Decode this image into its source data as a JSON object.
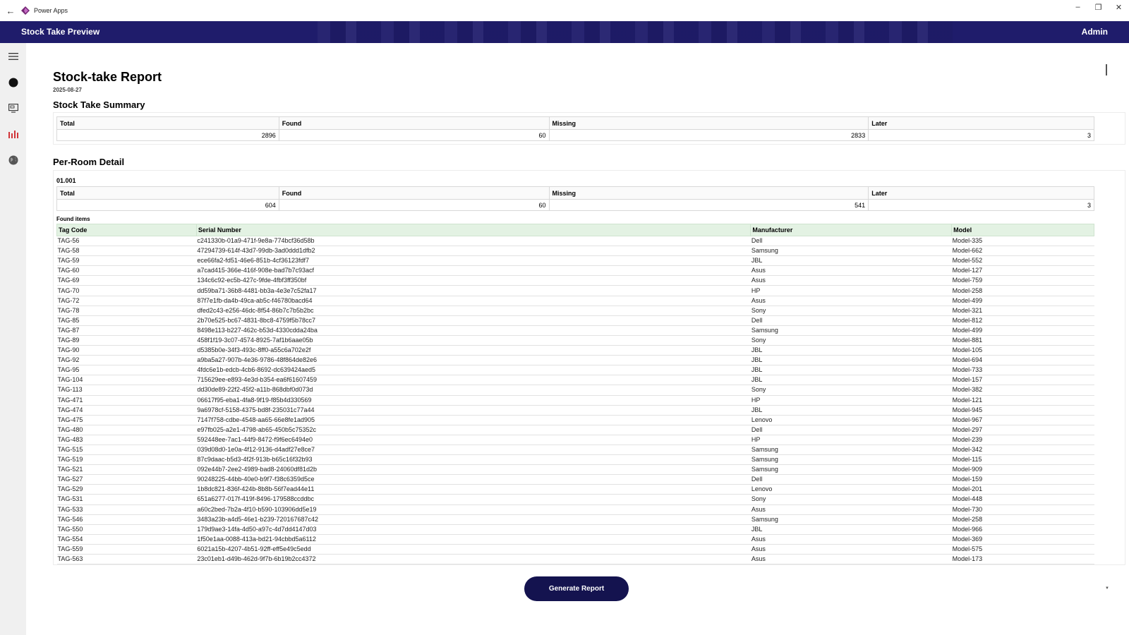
{
  "window": {
    "app_name": "Power Apps",
    "controls": [
      "minimize",
      "restore",
      "close"
    ]
  },
  "header": {
    "title": "Stock Take Preview",
    "user": "Admin",
    "bg_color": "#1f1c6b"
  },
  "sidebar": {
    "icons": [
      "menu-icon",
      "circle-icon",
      "monitor-icon",
      "bar-chart-icon",
      "globe-icon"
    ],
    "active_color": "#d13438"
  },
  "report": {
    "title": "Stock-take Report",
    "date": "2025-08-27",
    "summary_title": "Stock Take Summary",
    "summary": {
      "headers": [
        "Total",
        "Found",
        "Missing",
        "Later"
      ],
      "values": [
        "2896",
        "60",
        "2833",
        "3"
      ]
    },
    "per_room_title": "Per-Room Detail",
    "room": {
      "name": "01.001",
      "headers": [
        "Total",
        "Found",
        "Missing",
        "Later"
      ],
      "values": [
        "604",
        "60",
        "541",
        "3"
      ],
      "found_items_label": "Found items",
      "item_headers": [
        "Tag Code",
        "Serial Number",
        "Manufacturer",
        "Model"
      ],
      "items": [
        [
          "TAG-56",
          "c241330b-01a9-471f-9e8a-774bcf36d58b",
          "Dell",
          "Model-335"
        ],
        [
          "TAG-58",
          "47294739-614f-43d7-99db-3ad0ddd1dfb2",
          "Samsung",
          "Model-662"
        ],
        [
          "TAG-59",
          "ece66fa2-fd51-46e6-851b-4cf36123fdf7",
          "JBL",
          "Model-552"
        ],
        [
          "TAG-60",
          "a7cad415-366e-416f-908e-bad7b7c93acf",
          "Asus",
          "Model-127"
        ],
        [
          "TAG-69",
          "134c6c92-ec5b-427c-9fde-4fbf3ff350bf",
          "Asus",
          "Model-759"
        ],
        [
          "TAG-70",
          "dd59ba71-36b8-4481-bb3a-4e3e7c52fa17",
          "HP",
          "Model-258"
        ],
        [
          "TAG-72",
          "87f7e1fb-da4b-49ca-ab5c-f46780bacd64",
          "Asus",
          "Model-499"
        ],
        [
          "TAG-78",
          "dfed2c43-e256-46dc-8f54-86b7c7b5b2bc",
          "Sony",
          "Model-321"
        ],
        [
          "TAG-85",
          "2b70e525-bc67-4831-8bc8-4759f5b78cc7",
          "Dell",
          "Model-812"
        ],
        [
          "TAG-87",
          "8498e113-b227-462c-b53d-4330cdda24ba",
          "Samsung",
          "Model-499"
        ],
        [
          "TAG-89",
          "458f1f19-3c07-4574-8925-7af1b6aae05b",
          "Sony",
          "Model-881"
        ],
        [
          "TAG-90",
          "d5385b0e-34f3-493c-8ff0-a55c6a702e2f",
          "JBL",
          "Model-105"
        ],
        [
          "TAG-92",
          "a9ba5a27-907b-4e36-9786-48f864de82e6",
          "JBL",
          "Model-694"
        ],
        [
          "TAG-95",
          "4fdc6e1b-edcb-4cb6-8692-dc639424aed5",
          "JBL",
          "Model-733"
        ],
        [
          "TAG-104",
          "715629ee-e893-4e3d-b354-ea6f61607459",
          "JBL",
          "Model-157"
        ],
        [
          "TAG-113",
          "dd30de89-22f2-45f2-a11b-868dbf0d073d",
          "Sony",
          "Model-382"
        ],
        [
          "TAG-471",
          "06617f95-eba1-4fa8-9f19-f85b4d330569",
          "HP",
          "Model-121"
        ],
        [
          "TAG-474",
          "9a6978cf-5158-4375-bd8f-235031c77a44",
          "JBL",
          "Model-945"
        ],
        [
          "TAG-475",
          "7147f758-cdbe-4548-aa65-66e8fe1ad905",
          "Lenovo",
          "Model-967"
        ],
        [
          "TAG-480",
          "e97fb025-a2e1-4798-ab65-450b5c75352c",
          "Dell",
          "Model-297"
        ],
        [
          "TAG-483",
          "592448ee-7ac1-44f9-8472-f9f6ec6494e0",
          "HP",
          "Model-239"
        ],
        [
          "TAG-515",
          "039d08d0-1e0a-4f12-9136-d4adf27e8ce7",
          "Samsung",
          "Model-342"
        ],
        [
          "TAG-519",
          "87c9daac-b5d3-4f2f-913b-b65c16f32b93",
          "Samsung",
          "Model-115"
        ],
        [
          "TAG-521",
          "092e44b7-2ee2-4989-bad8-24060df81d2b",
          "Samsung",
          "Model-909"
        ],
        [
          "TAG-527",
          "90248225-44bb-40e0-b9f7-f38c6359d5ce",
          "Dell",
          "Model-159"
        ],
        [
          "TAG-529",
          "1b8dc821-836f-424b-8b8b-56f7ead44e11",
          "Lenovo",
          "Model-201"
        ],
        [
          "TAG-531",
          "651a6277-017f-419f-8496-179588ccddbc",
          "Sony",
          "Model-448"
        ],
        [
          "TAG-533",
          "a60c2bed-7b2a-4f10-b590-103906dd5e19",
          "Asus",
          "Model-730"
        ],
        [
          "TAG-546",
          "3483a23b-a4d5-46e1-b239-720167687c42",
          "Samsung",
          "Model-258"
        ],
        [
          "TAG-550",
          "179d9ae3-14fa-4d50-a97c-4d7dd4147d03",
          "JBL",
          "Model-966"
        ],
        [
          "TAG-554",
          "1f50e1aa-0088-413a-bd21-94cbbd5a6112",
          "Asus",
          "Model-369"
        ],
        [
          "TAG-559",
          "6021a15b-4207-4b51-92ff-eff5e49c5edd",
          "Asus",
          "Model-575"
        ],
        [
          "TAG-563",
          "23c01eb1-d49b-462d-9f7b-6b19b2cc4372",
          "Asus",
          "Model-173"
        ]
      ]
    }
  },
  "actions": {
    "generate_label": "Generate Report",
    "button_color": "#14134f"
  }
}
